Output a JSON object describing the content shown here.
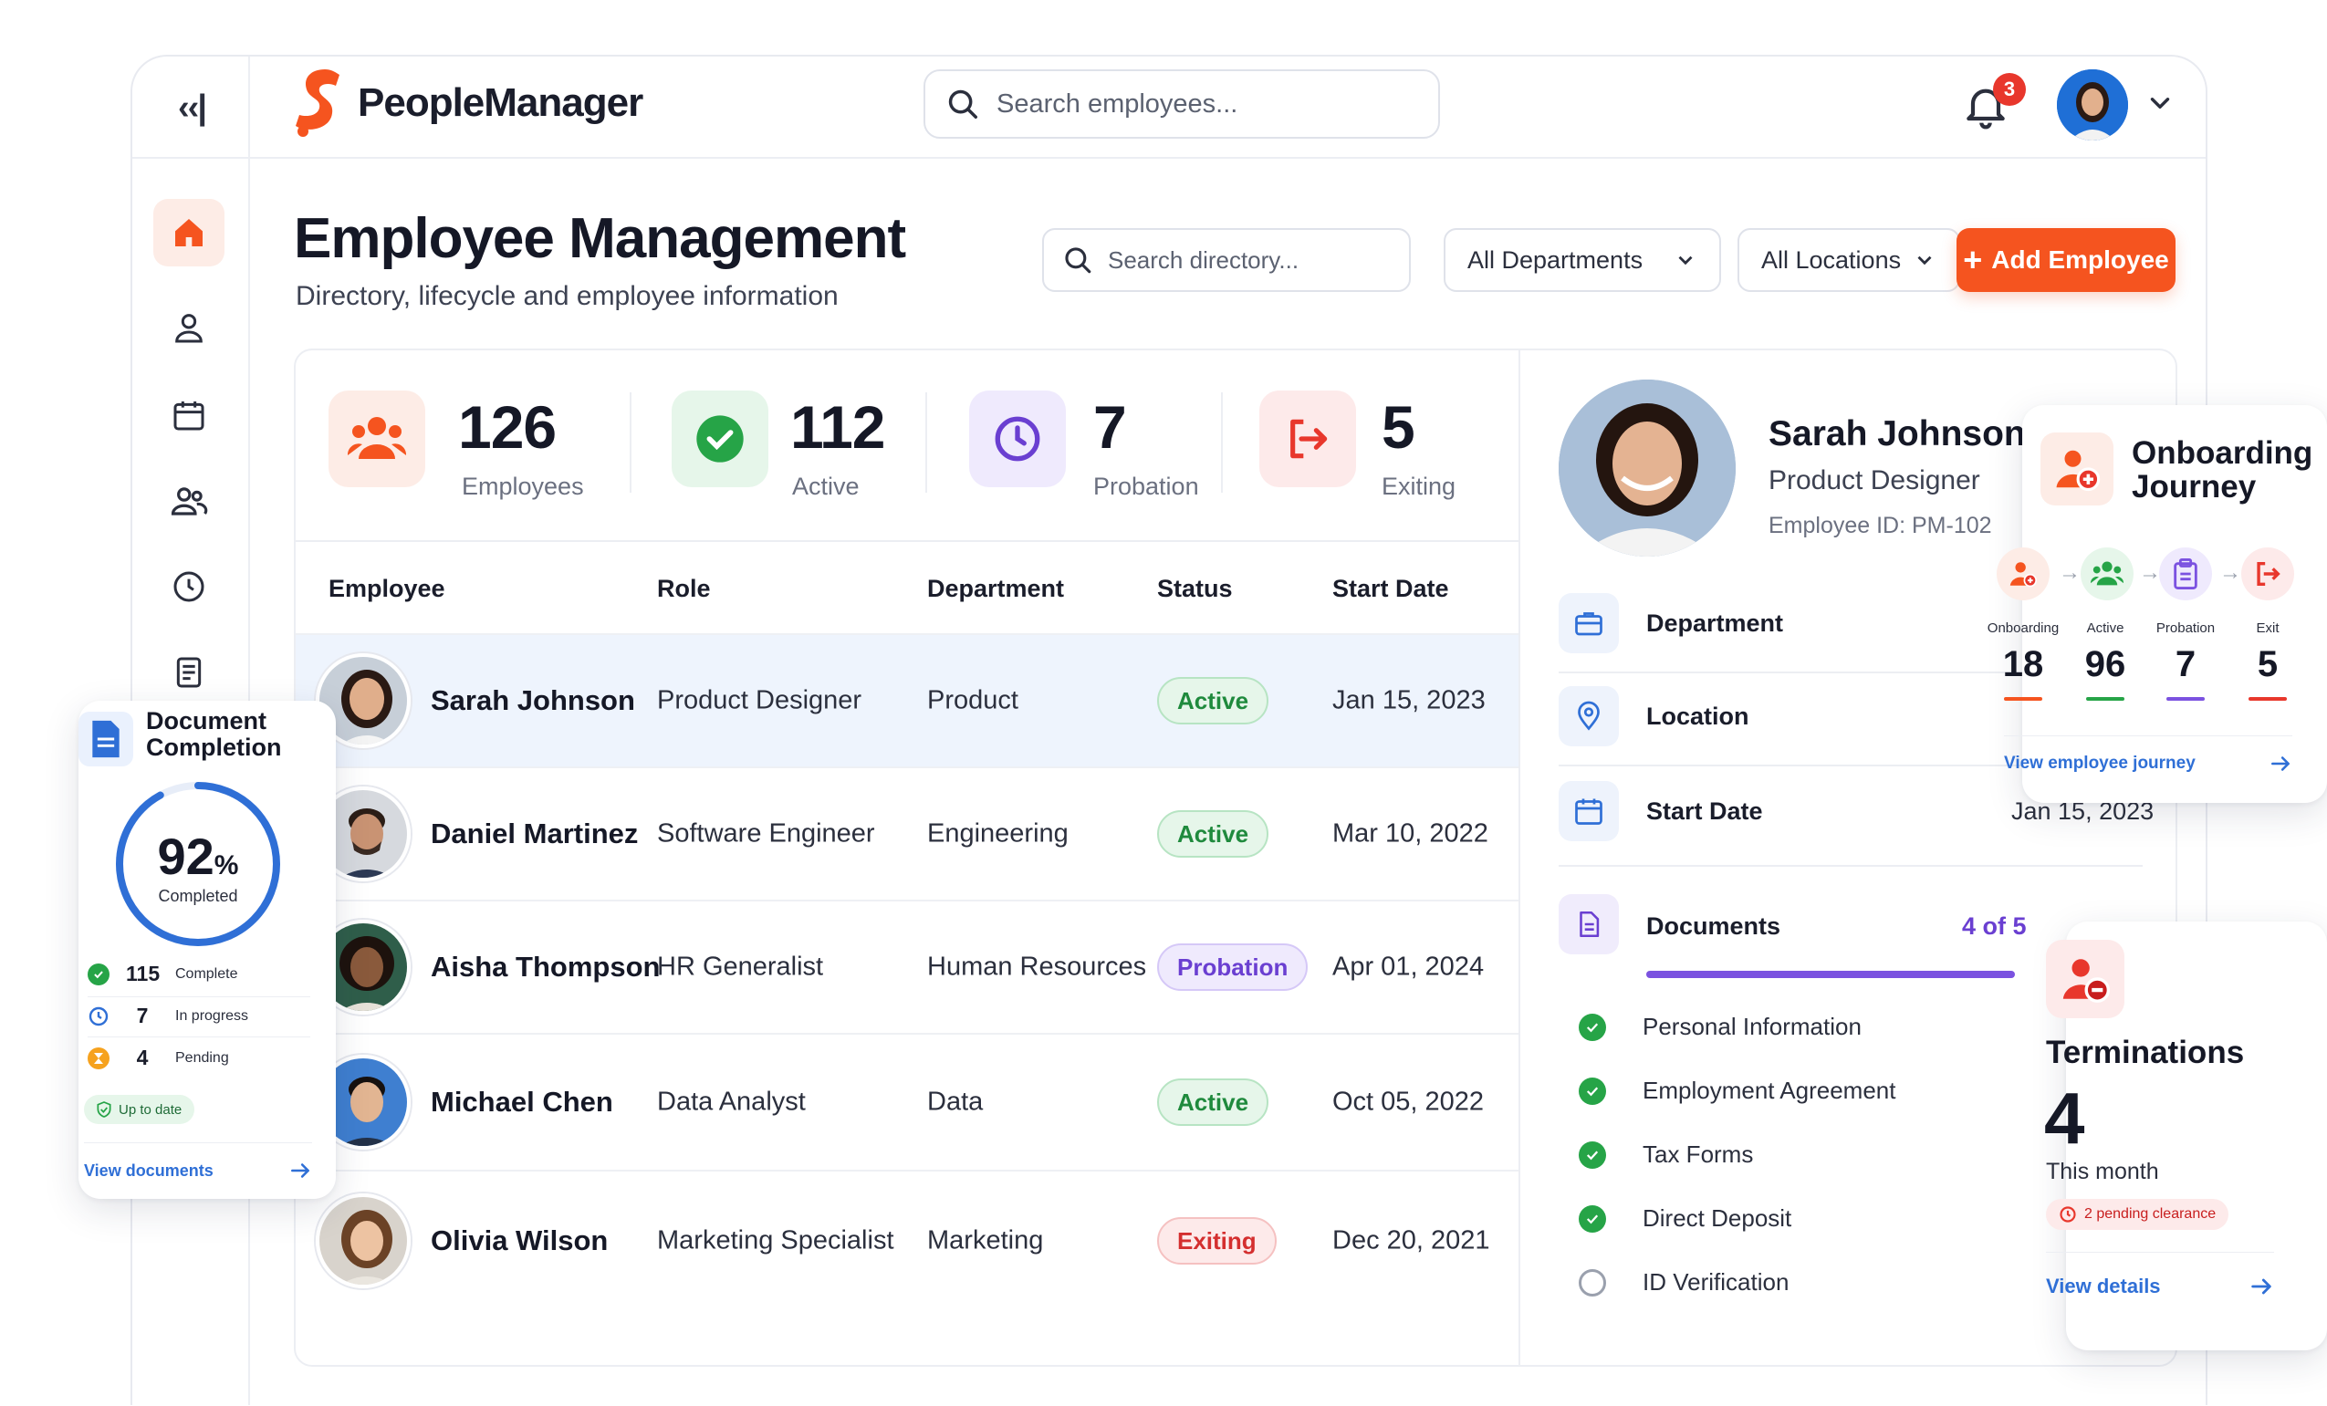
{
  "app": {
    "name": "PeopleManager",
    "search_placeholder": "Search employees...",
    "notification_count": "3"
  },
  "page": {
    "title": "Employee Management",
    "subtitle": "Directory, lifecycle and employee information",
    "directory_search_placeholder": "Search directory...",
    "department_filter": "All Departments",
    "location_filter": "All Locations",
    "add_button": "Add Employee"
  },
  "stats": [
    {
      "value": "126",
      "label": "Employees",
      "color": "#f5541f"
    },
    {
      "value": "112",
      "label": "Active",
      "color": "#26a447"
    },
    {
      "value": "7",
      "label": "Probation",
      "color": "#6a3fd1"
    },
    {
      "value": "5",
      "label": "Exiting",
      "color": "#e8372c"
    }
  ],
  "table": {
    "columns": [
      "Employee",
      "Role",
      "Department",
      "Status",
      "Start Date"
    ],
    "rows": [
      {
        "name": "Sarah Johnson",
        "role": "Product Designer",
        "department": "Product",
        "status": "Active",
        "start": "Jan 15, 2023"
      },
      {
        "name": "Daniel Martinez",
        "role": "Software Engineer",
        "department": "Engineering",
        "status": "Active",
        "start": "Mar 10, 2022"
      },
      {
        "name": "Aisha Thompson",
        "role": "HR Generalist",
        "department": "Human Resources",
        "status": "Probation",
        "start": "Apr 01, 2024"
      },
      {
        "name": "Michael Chen",
        "role": "Data Analyst",
        "department": "Data",
        "status": "Active",
        "start": "Oct 05, 2022"
      },
      {
        "name": "Olivia Wilson",
        "role": "Marketing Specialist",
        "department": "Marketing",
        "status": "Exiting",
        "start": "Dec 20, 2021"
      }
    ]
  },
  "profile": {
    "name": "Sarah Johnson",
    "role": "Product Designer",
    "employee_id": "Employee ID: PM-102",
    "department_label": "Department",
    "location_label": "Location",
    "start_label": "Start Date",
    "start_value": "Jan 15, 2023",
    "documents_label": "Documents",
    "documents_count": "4 of 5",
    "documents_progress": 0.8,
    "documents": [
      {
        "label": "Personal Information",
        "done": true
      },
      {
        "label": "Employment Agreement",
        "done": true
      },
      {
        "label": "Tax Forms",
        "done": true
      },
      {
        "label": "Direct Deposit",
        "done": true
      },
      {
        "label": "ID Verification",
        "done": false
      }
    ]
  },
  "doc_completion": {
    "title_line1": "Document",
    "title_line2": "Completion",
    "percent": "92",
    "percent_sign": "%",
    "percent_value": 0.92,
    "percent_caption": "Completed",
    "items": [
      {
        "value": "115",
        "label": "Complete"
      },
      {
        "value": "7",
        "label": "In progress"
      },
      {
        "value": "4",
        "label": "Pending"
      }
    ],
    "status_pill": "Up to date",
    "link": "View documents"
  },
  "onboarding": {
    "title_line1": "Onboarding",
    "title_line2": "Journey",
    "stages": [
      {
        "label": "Onboarding",
        "value": "18",
        "color": "#f5541f"
      },
      {
        "label": "Active",
        "value": "96",
        "color": "#26a447"
      },
      {
        "label": "Probation",
        "value": "7",
        "color": "#7b52e0"
      },
      {
        "label": "Exit",
        "value": "5",
        "color": "#e8372c"
      }
    ],
    "link": "View employee journey"
  },
  "terminations": {
    "title": "Terminations",
    "value": "4",
    "caption": "This month",
    "pill": "2 pending clearance",
    "link": "View details"
  }
}
